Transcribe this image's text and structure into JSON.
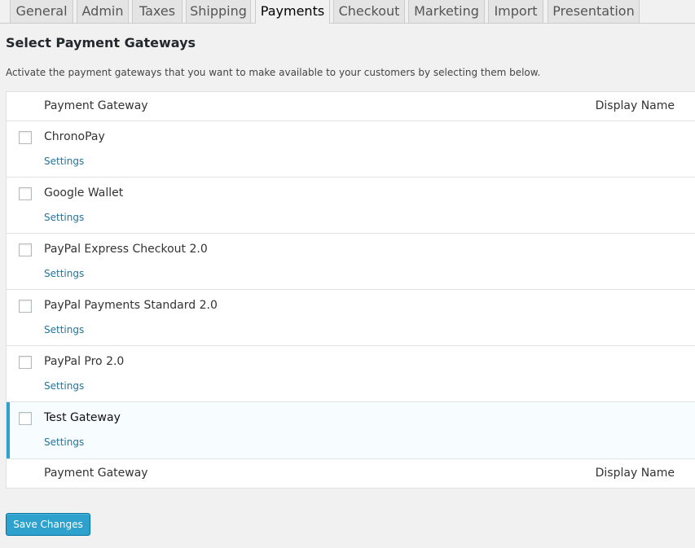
{
  "tabs": [
    {
      "label": "General",
      "active": false
    },
    {
      "label": "Admin",
      "active": false
    },
    {
      "label": "Taxes",
      "active": false
    },
    {
      "label": "Shipping",
      "active": false
    },
    {
      "label": "Payments",
      "active": true
    },
    {
      "label": "Checkout",
      "active": false
    },
    {
      "label": "Marketing",
      "active": false
    },
    {
      "label": "Import",
      "active": false
    },
    {
      "label": "Presentation",
      "active": false
    }
  ],
  "page": {
    "title": "Select Payment Gateways",
    "description": "Activate the payment gateways that you want to make available to your customers by selecting them below."
  },
  "table": {
    "header": {
      "gateway": "Payment Gateway",
      "display_name": "Display Name"
    },
    "footer": {
      "gateway": "Payment Gateway",
      "display_name": "Display Name"
    },
    "rows": [
      {
        "name": "ChronoPay",
        "settings": "Settings",
        "checked": false
      },
      {
        "name": "Google Wallet",
        "settings": "Settings",
        "checked": false
      },
      {
        "name": "PayPal Express Checkout 2.0",
        "settings": "Settings",
        "checked": false
      },
      {
        "name": "PayPal Payments Standard 2.0",
        "settings": "Settings",
        "checked": false
      },
      {
        "name": "PayPal Pro 2.0",
        "settings": "Settings",
        "checked": false
      },
      {
        "name": "Test Gateway",
        "settings": "Settings",
        "checked": false,
        "highlighted": true
      }
    ]
  },
  "actions": {
    "save_label": "Save Changes"
  },
  "colors": {
    "accent": "#2ea2cc",
    "link": "#21759b",
    "background": "#f1f1f1"
  }
}
